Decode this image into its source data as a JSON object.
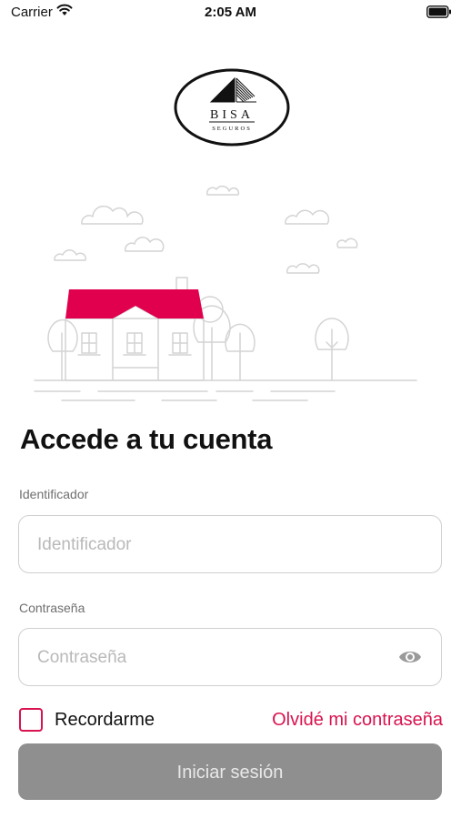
{
  "status_bar": {
    "carrier": "Carrier",
    "time": "2:05 AM",
    "icons": [
      "wifi-icon",
      "battery-icon"
    ]
  },
  "logo": {
    "brand": "BISA",
    "tagline": "SEGUROS"
  },
  "colors": {
    "accent": "#d8134f",
    "button_disabled": "#8f8f8f",
    "roof": "#e0004d"
  },
  "login": {
    "title": "Accede a tu cuenta",
    "identifier_label": "Identificador",
    "identifier_placeholder": "Identificador",
    "password_label": "Contraseña",
    "password_placeholder": "Contraseña",
    "remember_label": "Recordarme",
    "forgot_link": "Olvidé mi contraseña",
    "submit_label": "Iniciar sesión"
  }
}
